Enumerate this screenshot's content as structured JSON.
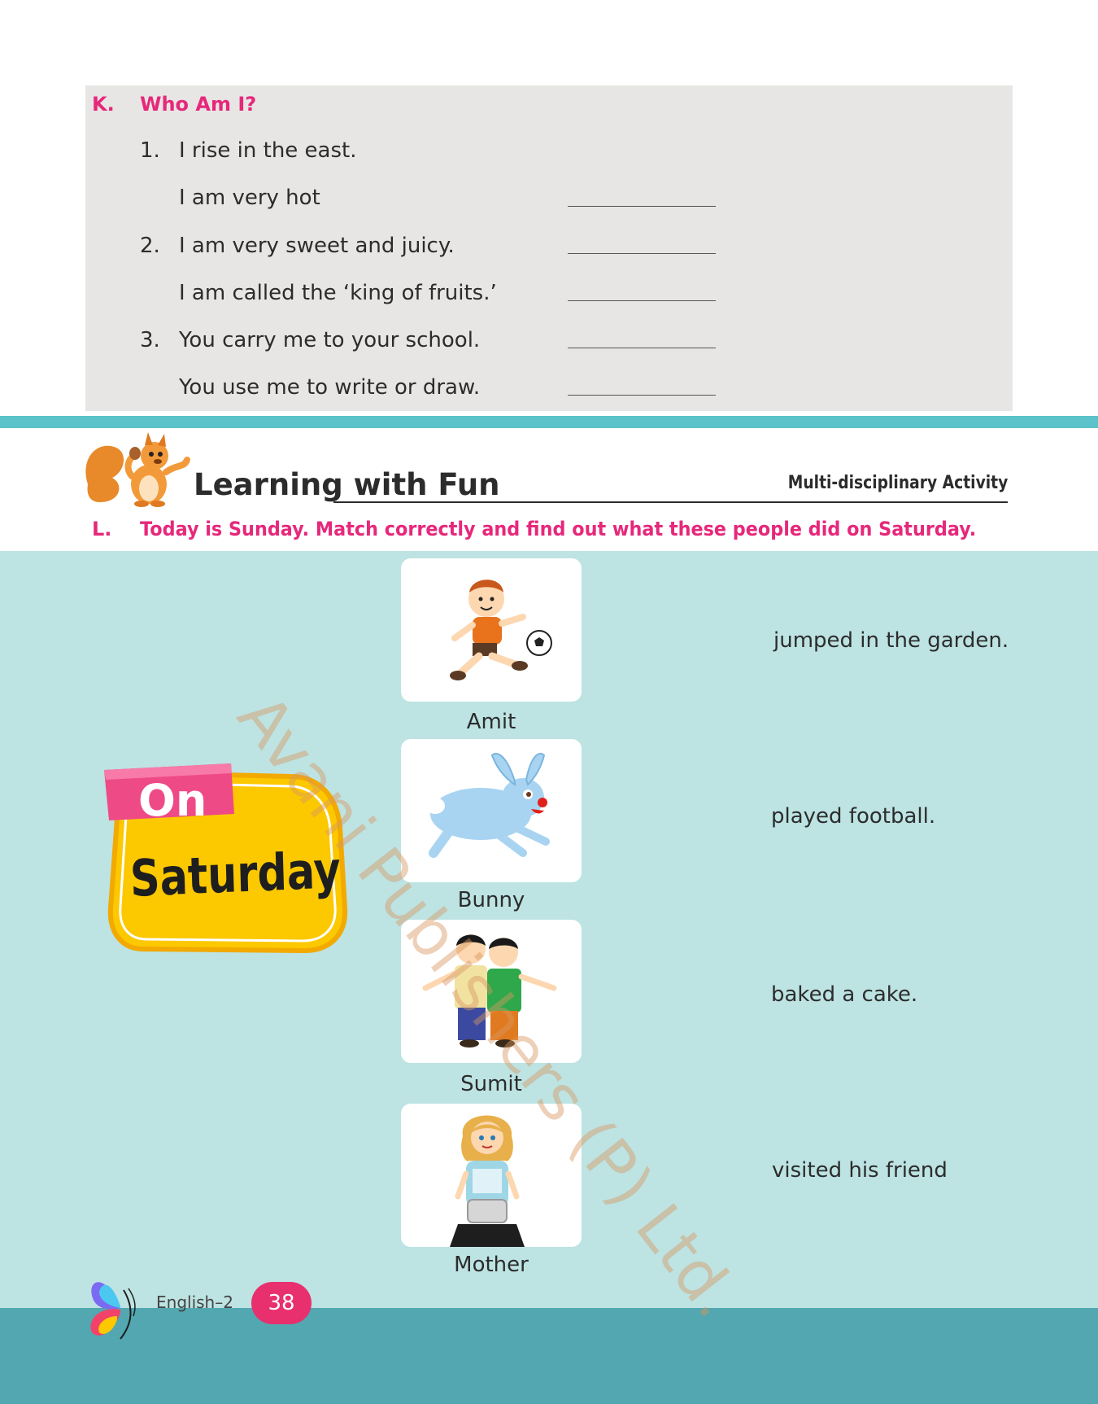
{
  "section_k": {
    "letter": "K.",
    "title": "Who Am I?",
    "questions": [
      {
        "num": "1.",
        "lines": [
          "I rise in the east.",
          "I am very hot"
        ]
      },
      {
        "num": "2.",
        "lines": [
          "I am very sweet and juicy.",
          "I am called the ‘king of fruits.’"
        ]
      },
      {
        "num": "3.",
        "lines": [
          "You carry me to your school.",
          "You use me to write or draw."
        ]
      }
    ]
  },
  "header": {
    "title": "Learning with Fun",
    "tag": "Multi-disciplinary Activity"
  },
  "section_l": {
    "letter": "L.",
    "instruction": "Today is Sunday. Match correctly and find out what these people did on Saturday.",
    "badge_top": "On",
    "badge_bottom": "Saturday",
    "people": [
      "Amit",
      "Bunny",
      "Sumit",
      "Mother"
    ],
    "actions": [
      "jumped in the garden.",
      "played football.",
      "baked a cake.",
      "visited his friend"
    ]
  },
  "watermark": "Avani Publishers (P) Ltd.",
  "footer": {
    "subject": "English–2",
    "page": "38"
  },
  "colors": {
    "accent_pink": "#e6287b",
    "teal_stripe": "#5bc3c9",
    "teal_light": "#bde3e3",
    "teal_dark": "#52a7b0",
    "badge_yellow": "#fcc800",
    "badge_pink": "#ee4a86"
  },
  "icons": [
    "squirrel-icon",
    "butterfly-icon",
    "football-player-image",
    "rabbit-image",
    "two-boys-image",
    "mother-cooking-image"
  ]
}
